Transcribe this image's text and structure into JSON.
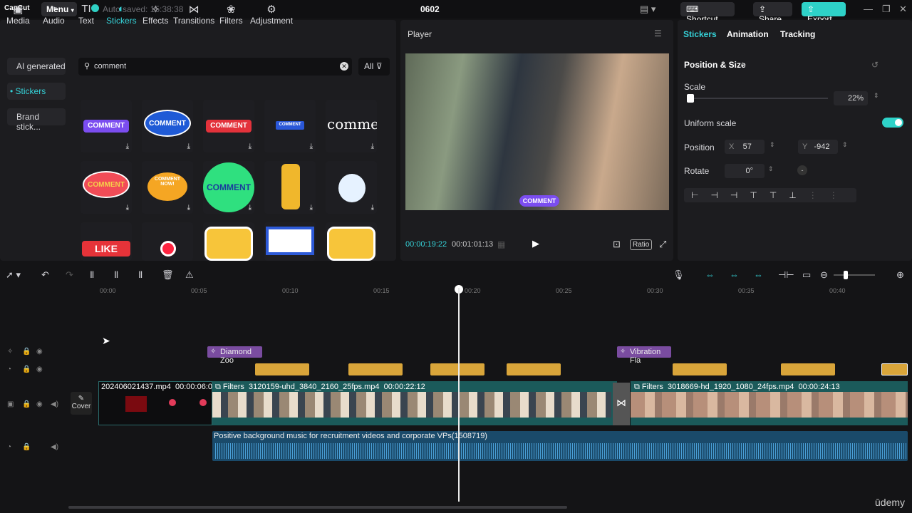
{
  "app": {
    "logo": "CapCut",
    "menu_label": "Menu",
    "autosave": "Auto saved: 15:38:38",
    "project_title": "0602",
    "shortcut_label": "Shortcut",
    "share_label": "Share",
    "export_label": "Export"
  },
  "nav": {
    "items": [
      {
        "label": "Media",
        "icon": "▣"
      },
      {
        "label": "Audio",
        "icon": "◔"
      },
      {
        "label": "Text",
        "icon": "TI"
      },
      {
        "label": "Stickers",
        "icon": "◐"
      },
      {
        "label": "Effects",
        "icon": "✧"
      },
      {
        "label": "Transitions",
        "icon": "⋈"
      },
      {
        "label": "Filters",
        "icon": "❀"
      },
      {
        "label": "Adjustment",
        "icon": "⚙"
      }
    ]
  },
  "categories": {
    "ai": "AI generated",
    "stickers": "• Stickers",
    "brand": "Brand stick..."
  },
  "search": {
    "value": "comment",
    "filter_label": "All"
  },
  "stickers": [
    {
      "label": "COMMENT",
      "bg": "#7b4df0",
      "fg": "#fff",
      "shape": "pill"
    },
    {
      "label": "COMMENT",
      "bg": "#1f5ad6",
      "fg": "#fff",
      "shape": "bubble"
    },
    {
      "label": "COMMENT",
      "bg": "#e3323b",
      "fg": "#fff",
      "shape": "pill"
    },
    {
      "label": "COMMENT",
      "bg": "#2a57d8",
      "fg": "#fff",
      "shape": "small"
    },
    {
      "label": "comment",
      "bg": "transparent",
      "fg": "#fff",
      "shape": "text"
    },
    {
      "label": "COMMENT",
      "bg": "#f24c57",
      "fg": "#f5d04a",
      "shape": "bubble"
    },
    {
      "label": "COMMENT NOW!",
      "bg": "#f5a623",
      "fg": "#fff",
      "shape": "dots"
    },
    {
      "label": "COMMENT",
      "bg": "#2fe07f",
      "fg": "#1a3d9c",
      "shape": "circle"
    },
    {
      "label": "",
      "bg": "#f0b72c",
      "fg": "#fff",
      "shape": "hand"
    },
    {
      "label": "",
      "bg": "#e6f2ff",
      "fg": "#333",
      "shape": "robot"
    },
    {
      "label": "LIKE",
      "bg": "#e63339",
      "fg": "#fff",
      "shape": "like"
    },
    {
      "label": "",
      "bg": "#ff2440",
      "fg": "#fff",
      "shape": "dot"
    },
    {
      "label": "",
      "bg": "#f7c53a",
      "fg": "#333",
      "shape": "dots2"
    },
    {
      "label": "",
      "bg": "#2d5ad8",
      "fg": "#fff",
      "shape": "frame"
    },
    {
      "label": "",
      "bg": "#f7c53a",
      "fg": "#333",
      "shape": "dots2"
    }
  ],
  "player": {
    "title": "Player",
    "current_time": "00:00:19:22",
    "total_time": "00:01:01:13",
    "ratio_label": "Ratio",
    "overlay_label": "COMMENT"
  },
  "inspector": {
    "tabs": [
      "Stickers",
      "Animation",
      "Tracking"
    ],
    "section": "Position & Size",
    "scale_label": "Scale",
    "scale_value": "22%",
    "scale_fraction": 0.22,
    "uniform_label": "Uniform scale",
    "position_label": "Position",
    "x_label": "X",
    "x_value": "57",
    "y_label": "Y",
    "y_value": "-942",
    "rotate_label": "Rotate",
    "rotate_value": "0°"
  },
  "timeline": {
    "ticks": [
      "00:00",
      "00:05",
      "00:10",
      "00:15",
      "00:20",
      "00:25",
      "00:30",
      "00:35",
      "00:40"
    ],
    "fx_clips": [
      {
        "label": "Diamond Zoo"
      },
      {
        "label": "Vibration Fla"
      }
    ],
    "video_clips": [
      {
        "file": "202406021437.mp4",
        "duration": "00:00:06:07"
      },
      {
        "prefix": "Filters",
        "file": "3120159-uhd_3840_2160_25fps.mp4",
        "duration": "00:00:22:12"
      },
      {
        "prefix": "Filters",
        "file": "3018669-hd_1920_1080_24fps.mp4",
        "duration": "00:00:24:13"
      }
    ],
    "audio_label": "Positive background music for recruitment videos and corporate VPs(1508719)",
    "cover_label": "Cover"
  },
  "watermark": "ūdemy"
}
